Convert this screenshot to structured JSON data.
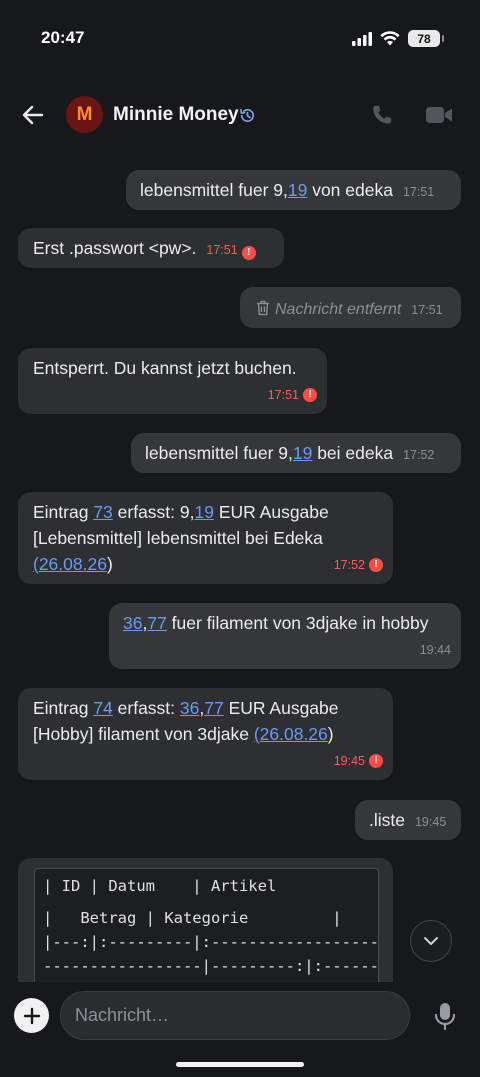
{
  "status": {
    "time": "20:47",
    "battery": "78"
  },
  "header": {
    "avatar_letter": "M",
    "contact_name": "Minnie Money"
  },
  "messages": {
    "m1": {
      "parts": [
        "lebensmittel fuer 9,",
        "19",
        " von edeka"
      ],
      "time": "17:51"
    },
    "m2": {
      "text": "Erst .passwort <pw>.",
      "time": "17:51"
    },
    "m3": {
      "text": "Nachricht entfernt",
      "time": "17:51"
    },
    "m4": {
      "text": "Entsperrt. Du kannst jetzt buchen.",
      "time": "17:51"
    },
    "m5": {
      "parts": [
        "lebensmittel fuer 9,",
        "19",
        " bei edeka"
      ],
      "time": "17:52"
    },
    "m6": {
      "parts": [
        "Eintrag ",
        "73",
        " erfasst: 9,",
        "19",
        " EUR  Ausgabe",
        "[Lebensmittel]  lebensmittel bei Edeka",
        "(",
        "26.08.26",
        ")"
      ],
      "time": "17:52"
    },
    "m7": {
      "parts": [
        "36",
        ",",
        "77",
        " fuer filament von 3djake in hobby"
      ],
      "time": "19:44"
    },
    "m8": {
      "parts": [
        "Eintrag ",
        "74",
        " erfasst: ",
        "36",
        ",",
        "77",
        " EUR  Ausgabe",
        "[Hobby]  filament von 3djake  ",
        "(",
        "26.08.26",
        ")"
      ],
      "time": "19:45"
    },
    "m9": {
      "text": ".liste",
      "time": "19:45"
    }
  },
  "code_block": {
    "lines": [
      "| ID | Datum    | Artikel",
      "|   Betrag | Kategorie         |",
      "|---:|:---------|:------------------",
      "-----------------|---------:|:------"
    ]
  },
  "composer": {
    "placeholder": "Nachricht…"
  },
  "colors": {
    "background": "#17181c",
    "bubble": "#2e2f33",
    "link": "#6a9bf2",
    "error": "#ff4c45",
    "avatar_bg": "#6b1414",
    "avatar_fg": "#ff8a30"
  }
}
